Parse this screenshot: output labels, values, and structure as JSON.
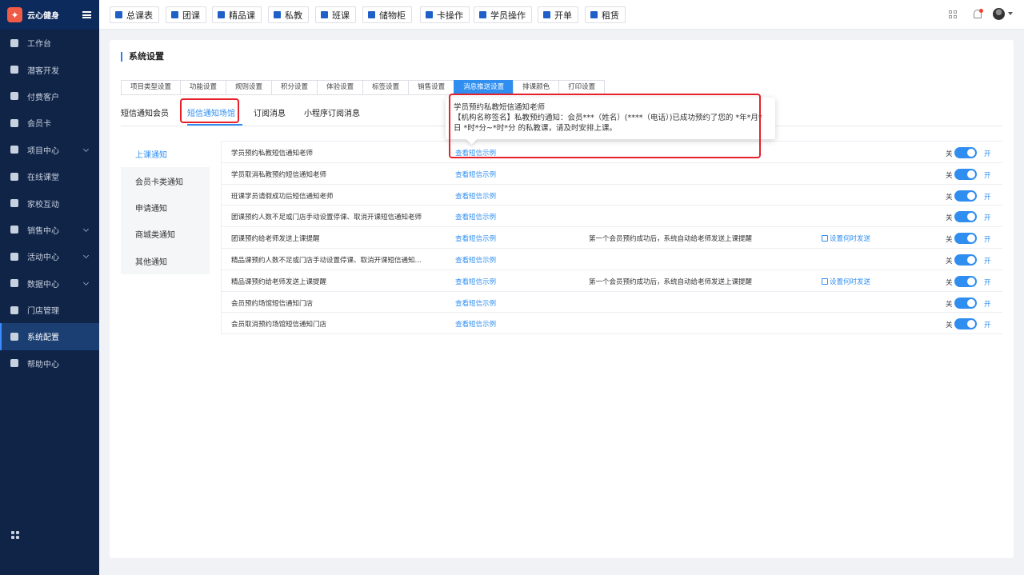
{
  "app": {
    "name": "云心健身"
  },
  "sidebar": {
    "items": [
      {
        "label": "工作台",
        "icon": "monitor-icon",
        "expandable": false
      },
      {
        "label": "潜客开发",
        "icon": "contact-card-icon",
        "expandable": false
      },
      {
        "label": "付费客户",
        "icon": "users-icon",
        "expandable": false
      },
      {
        "label": "会员卡",
        "icon": "card-icon",
        "expandable": false
      },
      {
        "label": "项目中心",
        "icon": "folder-icon",
        "expandable": true
      },
      {
        "label": "在线课堂",
        "icon": "classroom-icon",
        "expandable": false
      },
      {
        "label": "家校互动",
        "icon": "book-icon",
        "expandable": false
      },
      {
        "label": "销售中心",
        "icon": "tag-icon",
        "expandable": true
      },
      {
        "label": "活动中心",
        "icon": "activity-icon",
        "expandable": true
      },
      {
        "label": "数据中心",
        "icon": "pie-chart-icon",
        "expandable": true
      },
      {
        "label": "门店管理",
        "icon": "store-icon",
        "expandable": false
      },
      {
        "label": "系统配置",
        "icon": "settings-icon",
        "expandable": false,
        "active": true
      },
      {
        "label": "帮助中心",
        "icon": "help-icon",
        "expandable": false
      }
    ]
  },
  "topbar": {
    "quick": [
      "总课表",
      "团课",
      "精品课",
      "私教",
      "班课",
      "储物柜",
      "卡操作",
      "学员操作",
      "开单",
      "租赁"
    ]
  },
  "page": {
    "title": "系统设置"
  },
  "tabs": [
    "项目类型设置",
    "功能设置",
    "规则设置",
    "积分设置",
    "体验设置",
    "标签设置",
    "销售设置",
    "消息推送设置",
    "排课颜色",
    "打印设置"
  ],
  "active_tab": "消息推送设置",
  "subtabs": [
    "短信通知会员",
    "短信通知场馆",
    "订阅消息",
    "小程序订阅消息"
  ],
  "active_subtab": "短信通知场馆",
  "categories": [
    "上课通知",
    "会员卡类通知",
    "申请通知",
    "商城类通知",
    "其他通知"
  ],
  "active_category": "上课通知",
  "rows": [
    {
      "name": "学员预约私教短信通知老师",
      "link": "查看短信示例",
      "note": "",
      "setting": "",
      "off": "关",
      "on": "开"
    },
    {
      "name": "学员取消私教预约短信通知老师",
      "link": "查看短信示例",
      "note": "",
      "setting": "",
      "off": "关",
      "on": "开"
    },
    {
      "name": "班课学员请假成功后短信通知老师",
      "link": "查看短信示例",
      "note": "",
      "setting": "",
      "off": "关",
      "on": "开"
    },
    {
      "name": "团课预约人数不足或门店手动设置停课、取消开课短信通知老师",
      "link": "查看短信示例",
      "note": "",
      "setting": "",
      "off": "关",
      "on": "开"
    },
    {
      "name": "团课预约给老师发送上课提醒",
      "link": "查看短信示例",
      "note": "第一个会员预约成功后，系统自动给老师发送上课提醒",
      "setting": "设置何时发送",
      "off": "关",
      "on": "开"
    },
    {
      "name": "精品课预约人数不足或门店手动设置停课、取消开课短信通知...",
      "link": "查看短信示例",
      "note": "",
      "setting": "",
      "off": "关",
      "on": "开"
    },
    {
      "name": "精品课预约给老师发送上课提醒",
      "link": "查看短信示例",
      "note": "第一个会员预约成功后，系统自动给老师发送上课提醒",
      "setting": "设置何时发送",
      "off": "关",
      "on": "开"
    },
    {
      "name": "会员预约场馆短信通知门店",
      "link": "查看短信示例",
      "note": "",
      "setting": "",
      "off": "关",
      "on": "开"
    },
    {
      "name": "会员取消预约场馆短信通知门店",
      "link": "查看短信示例",
      "note": "",
      "setting": "",
      "off": "关",
      "on": "开"
    }
  ],
  "tooltip": {
    "title": "学员预约私教短信通知老师",
    "body": "【机构名称签名】私教预约通知：会员***（姓名）(****（电话）)已成功预约了您的 *年*月*日 *时*分~*时*分 的私教课，请及时安排上课。"
  },
  "colors": {
    "primary": "#2f8ef0",
    "sidebar": "#0f2447",
    "highlight": "#e6212a"
  }
}
